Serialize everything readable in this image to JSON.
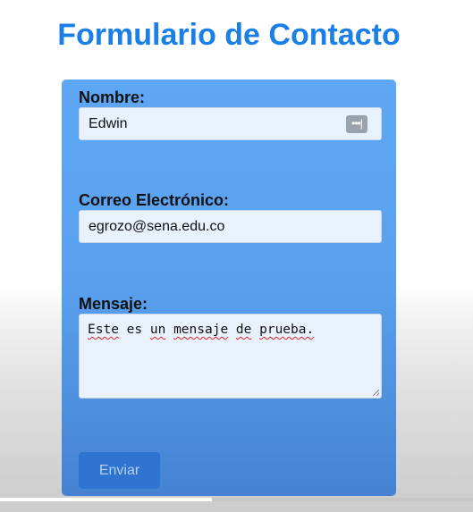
{
  "page": {
    "title": "Formulario de Contacto"
  },
  "form": {
    "name_label": "Nombre:",
    "name_value": "Edwin",
    "email_label": "Correo Electrónico:",
    "email_value": "egrozo@sena.edu.co",
    "message_label": "Mensaje:",
    "message_words": [
      "Este",
      "es",
      "un",
      "mensaje",
      "de",
      "prueba."
    ],
    "submit_label": "Enviar"
  },
  "icons": {
    "name_field_autofill": "password-manager-icon",
    "message_resize": "resize-grip-icon"
  },
  "colors": {
    "title": "#1a7fe6",
    "card": "#5aa2f0",
    "button": "#2f74d0",
    "input_bg": "#e9f1fd",
    "spellcheck": "#e0282e"
  },
  "progress": {
    "fraction": 0.448
  }
}
